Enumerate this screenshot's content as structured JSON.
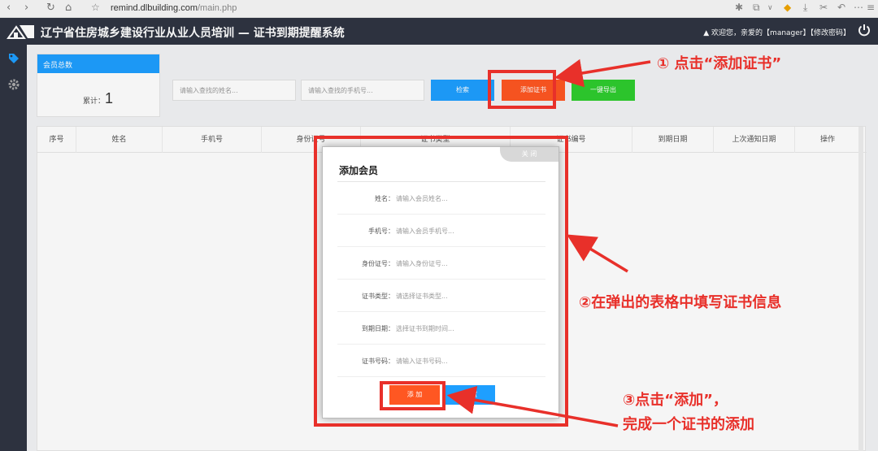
{
  "browser": {
    "url_host": "remind.dlbuilding.com",
    "url_path": "/main.php"
  },
  "header": {
    "title": "辽宁省住房城乡建设行业从业人员培训 — 证书到期提醒系统",
    "user_text": "欢迎您，亲爱的【manager】【修改密码】"
  },
  "summary": {
    "card_title": "会员总数",
    "total_label": "累计：",
    "total_value": "1"
  },
  "search": {
    "name_placeholder": "请输入查找的姓名...",
    "phone_placeholder": "请输入查找的手机号..."
  },
  "toolbar": {
    "search_label": "检索",
    "add_cert_label": "添加证书",
    "export_label": "一键导出"
  },
  "table": {
    "columns": [
      "序号",
      "姓名",
      "手机号",
      "身份证号",
      "证书类型",
      "证书编号",
      "到期日期",
      "上次通知日期",
      "操作"
    ]
  },
  "modal": {
    "close_label": "关 闭",
    "title": "添加会员",
    "fields": [
      {
        "label": "姓名：",
        "placeholder": "请输入会员姓名..."
      },
      {
        "label": "手机号：",
        "placeholder": "请输入会员手机号..."
      },
      {
        "label": "身份证号：",
        "placeholder": "请输入身份证号..."
      },
      {
        "label": "证书类型：",
        "placeholder": "请选择证书类型..."
      },
      {
        "label": "到期日期：",
        "placeholder": "选择证书到期时间..."
      },
      {
        "label": "证书号码：",
        "placeholder": "请输入证书号码..."
      }
    ],
    "add_label": "添 加",
    "reset_label": "重 置"
  },
  "annotations": {
    "step1": "① 点击“添加证书”",
    "step2": "②在弹出的表格中填写证书信息",
    "step3_line1": "③点击“添加”，",
    "step3_line2": "完成一个证书的添加"
  },
  "colors": {
    "header_bg": "#2f3542",
    "primary_blue": "#1e9fff",
    "orange": "#ff5722",
    "green": "#2ecc2e",
    "annotation_red": "#e8302a"
  }
}
